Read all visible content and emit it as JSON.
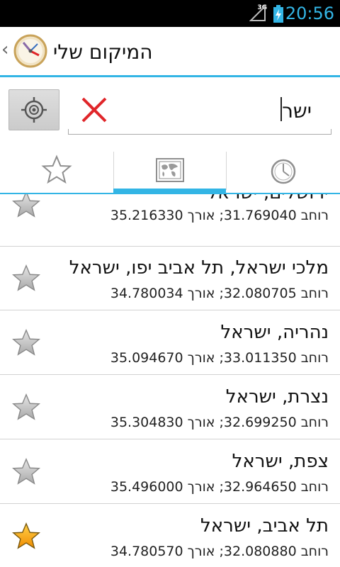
{
  "status_bar": {
    "time": "20:56",
    "network": "3G",
    "signal_icon": "signal-icon",
    "battery_icon": "battery-charging-icon"
  },
  "action_bar": {
    "title": "המיקום שלי",
    "up_icon": "chevron-left-icon",
    "logo_icon": "compass-logo-icon"
  },
  "search": {
    "value": "ישר",
    "clear_icon": "close-icon",
    "locate_icon": "gps-target-icon"
  },
  "tabs": [
    {
      "name": "favorites",
      "icon": "star-outline-icon"
    },
    {
      "name": "map",
      "icon": "map-icon",
      "selected": true
    },
    {
      "name": "history",
      "icon": "clock-icon"
    }
  ],
  "results": [
    {
      "place": "ירושלים, ישראל",
      "coords": "רוחב 31.769040; אורך 35.216330",
      "favorite": false
    },
    {
      "place": "מלכי ישראל, תל אביב יפו, ישראל",
      "coords": "רוחב 32.080705; אורך 34.780034",
      "favorite": false
    },
    {
      "place": "נהריה, ישראל",
      "coords": "רוחב 33.011350; אורך 35.094670",
      "favorite": false
    },
    {
      "place": "נצרת, ישראל",
      "coords": "רוחב 32.699250; אורך 35.304830",
      "favorite": false
    },
    {
      "place": "צפת, ישראל",
      "coords": "רוחב 32.964650; אורך 35.496000",
      "favorite": false
    },
    {
      "place": "תל אביב, ישראל",
      "coords": "רוחב 32.080880; אורך 34.780570",
      "favorite": true
    }
  ],
  "colors": {
    "accent": "#33b5e5",
    "star_gray": "#b9b9b9",
    "star_gold": "#f5b400",
    "clear_red": "#e0262a"
  }
}
